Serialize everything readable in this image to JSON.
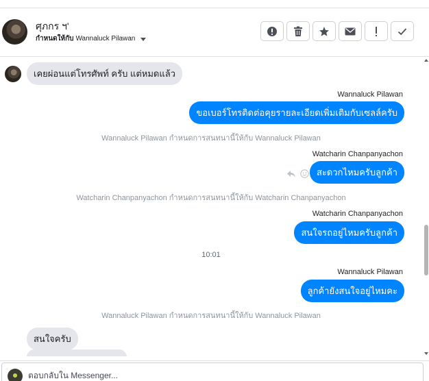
{
  "header": {
    "contact_name": "ศุภกร ฯ'",
    "assign_prefix": "กำหนดให้กับ",
    "assignee": "Wannaluck Pilawan",
    "actions": [
      {
        "icon": "exclamation-circle-icon"
      },
      {
        "icon": "trash-icon"
      },
      {
        "icon": "star-icon"
      },
      {
        "icon": "envelope-icon"
      },
      {
        "icon": "exclamation-icon"
      },
      {
        "icon": "check-icon"
      }
    ]
  },
  "messages": {
    "m1": "เคยผ่อนแต่โทรศัพท์ ครับ แต่หมดแล้ว",
    "s2": "Wannaluck Pilawan",
    "m2": "ขอเบอร์โทรติดต่อคุยรายละเอียดเพิ่มเติมกับเซลล์ครับ",
    "n1": "Wannaluck Pilawan กำหนดการสนทนานี้ให้กับ Wannaluck Pilawan",
    "s3": "Watcharin Chanpanyachon",
    "m3": "สะดวกไหมครับลูกค้า",
    "n2": "Watcharin Chanpanyachon กำหนดการสนทนานี้ให้กับ Watcharin Chanpanyachon",
    "s4": "Watcharin Chanpanyachon",
    "m4": "สนใจรถอยู่ไหมครับลูกค้า",
    "time": "10:01",
    "s5": "Wannaluck Pilawan",
    "m5": "ลูกค้ายังสนใจอยู่ไหมคะ",
    "n3": "Wannaluck Pilawan กำหนดการสนทนานี้ให้กับ Wannaluck Pilawan",
    "m6": "สนใจครับ"
  },
  "composer": {
    "placeholder": "ตอบกลับใน Messenger..."
  },
  "colors": {
    "outgoing_bubble": "#0084ff",
    "incoming_bubble": "#e4e6eb"
  }
}
